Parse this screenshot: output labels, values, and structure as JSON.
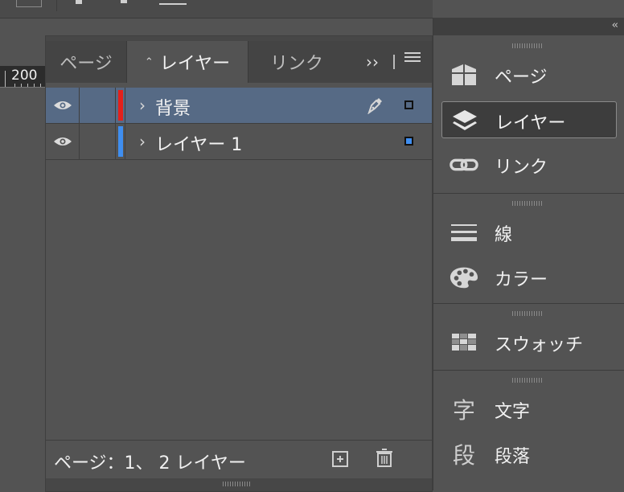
{
  "ruler": {
    "label": "200"
  },
  "layers_panel": {
    "tabs": [
      {
        "label": "ページ"
      },
      {
        "label": "レイヤー",
        "active": true
      },
      {
        "label": "リンク"
      }
    ],
    "more_label": "››",
    "layers": [
      {
        "name": "背景",
        "color": "#e4201b",
        "selected": true,
        "visible": true
      },
      {
        "name": "レイヤー 1",
        "color": "#3f8ef0",
        "selected": false,
        "visible": true
      }
    ],
    "footer_status": "ページ：1、 2 レイヤー"
  },
  "dock": {
    "collapse_label": "‹‹",
    "items": [
      {
        "label": "ページ",
        "icon": "pages-icon"
      },
      {
        "label": "レイヤー",
        "icon": "layers-icon",
        "active": true
      },
      {
        "label": "リンク",
        "icon": "link-icon"
      },
      {
        "label": "線",
        "icon": "stroke-icon"
      },
      {
        "label": "カラー",
        "icon": "palette-icon"
      },
      {
        "label": "スウォッチ",
        "icon": "swatches-icon"
      },
      {
        "label": "文字",
        "icon": "character-icon",
        "glyph": "字"
      },
      {
        "label": "段落",
        "icon": "paragraph-icon",
        "glyph": "段"
      }
    ]
  }
}
